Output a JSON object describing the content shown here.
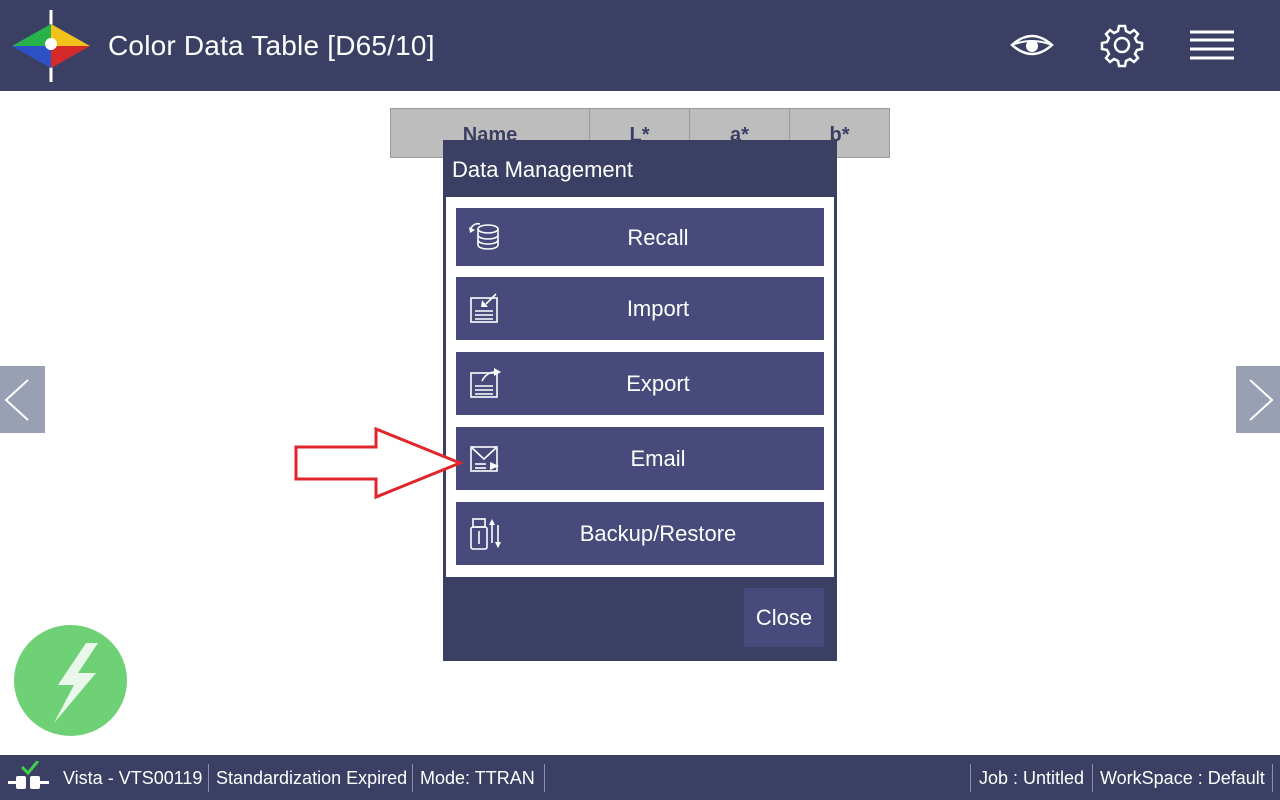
{
  "header": {
    "title": "Color Data Table [D65/10]",
    "icons": [
      "eye-icon",
      "gear-icon",
      "hamburger-menu-icon"
    ]
  },
  "table": {
    "columns": [
      "Name",
      "L*",
      "a*",
      "b*"
    ]
  },
  "dialog": {
    "title": "Data Management",
    "buttons": [
      {
        "label": "Recall",
        "icon": "database-recall-icon"
      },
      {
        "label": "Import",
        "icon": "import-document-icon"
      },
      {
        "label": "Export",
        "icon": "export-document-icon"
      },
      {
        "label": "Email",
        "icon": "email-icon"
      },
      {
        "label": "Backup/Restore",
        "icon": "usb-transfer-icon"
      }
    ],
    "close_label": "Close"
  },
  "footer": {
    "instrument": "Vista - VTS00119",
    "standardization": "Standardization Expired",
    "mode": "Mode:  TTRAN",
    "job": "Job : Untitled",
    "workspace": "WorkSpace : Default"
  },
  "colors": {
    "header_bg": "#3a3f63",
    "button_bg": "#474a7a",
    "annotation_arrow": "#e0262b",
    "bolt_green": "#6fd176"
  }
}
